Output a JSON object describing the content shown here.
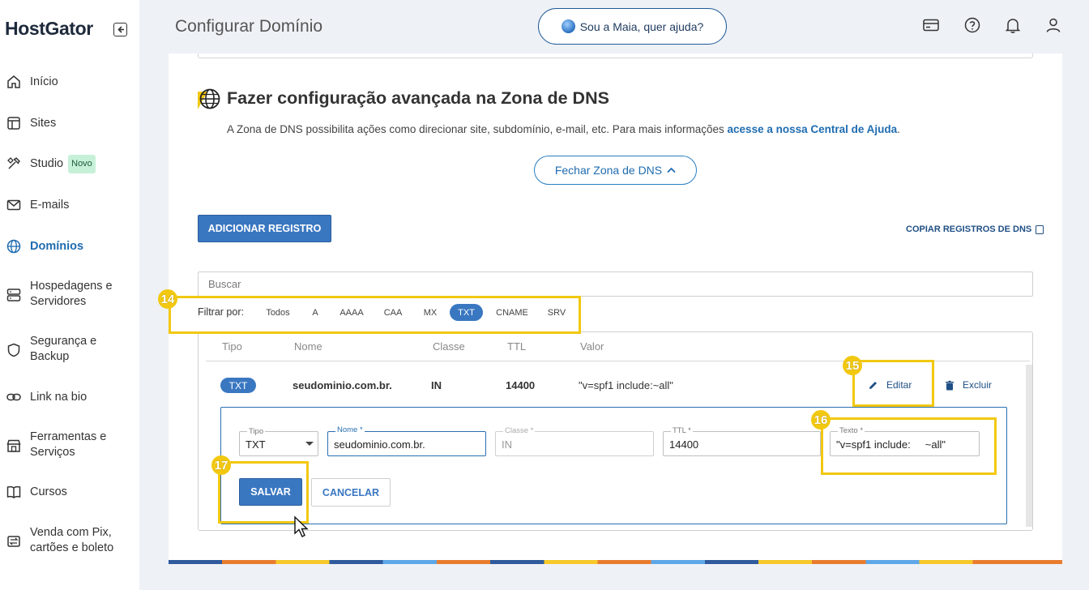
{
  "sidebar": {
    "logo": "HostGator",
    "items": [
      {
        "label": "Início"
      },
      {
        "label": "Sites"
      },
      {
        "label": "Studio",
        "badge": "Novo"
      },
      {
        "label": "E-mails"
      },
      {
        "label": "Domínios",
        "active": true
      },
      {
        "label": "Hospedagens e Servidores"
      },
      {
        "label": "Segurança e Backup"
      },
      {
        "label": "Link na bio"
      },
      {
        "label": "Ferramentas e Serviços"
      },
      {
        "label": "Cursos"
      },
      {
        "label": "Venda com Pix, cartões e boleto"
      }
    ]
  },
  "header": {
    "title": "Configurar Domínio",
    "assistant_label": "Sou a Maia, quer ajuda?"
  },
  "section": {
    "title": "Fazer configuração avançada na Zona de DNS",
    "description": "A Zona de DNS possibilita ações como direcionar site, subdomínio, e-mail, etc. Para mais informações ",
    "description_link": "acesse a nossa Central de Ajuda",
    "description_end": ".",
    "close_label": "Fechar Zona de DNS"
  },
  "toolbar": {
    "add_label": "ADICIONAR REGISTRO",
    "copy_label": "COPIAR REGISTROS DE DNS"
  },
  "search": {
    "placeholder": "Buscar"
  },
  "filter": {
    "label": "Filtrar por:",
    "chips": [
      "Todos",
      "A",
      "AAAA",
      "CAA",
      "MX",
      "TXT",
      "CNAME",
      "SRV"
    ],
    "active": "TXT"
  },
  "table": {
    "columns": [
      "Tipo",
      "Nome",
      "Classe",
      "TTL",
      "Valor"
    ],
    "row": {
      "tipo": "TXT",
      "nome": "seudominio.com.br.",
      "classe": "IN",
      "ttl": "14400",
      "valor": "\"v=spf1 include:~all\"",
      "edit_label": "Editar",
      "delete_label": "Excluir"
    }
  },
  "edit_form": {
    "tipo_label": "Tipo",
    "tipo_value": "TXT",
    "nome_label": "Nome *",
    "nome_value": "seudominio.com.br.",
    "classe_label": "Classe *",
    "classe_value": "IN",
    "ttl_label": "TTL *",
    "ttl_value": "14400",
    "texto_label": "Texto *",
    "texto_value": "\"v=spf1 include:     ~all\"",
    "save_label": "SALVAR",
    "cancel_label": "CANCELAR"
  },
  "callouts": [
    "14",
    "15",
    "16",
    "17"
  ],
  "colors": {
    "accent": "#3a77c1",
    "highlight": "#f2c811",
    "link": "#1f6cb0"
  }
}
